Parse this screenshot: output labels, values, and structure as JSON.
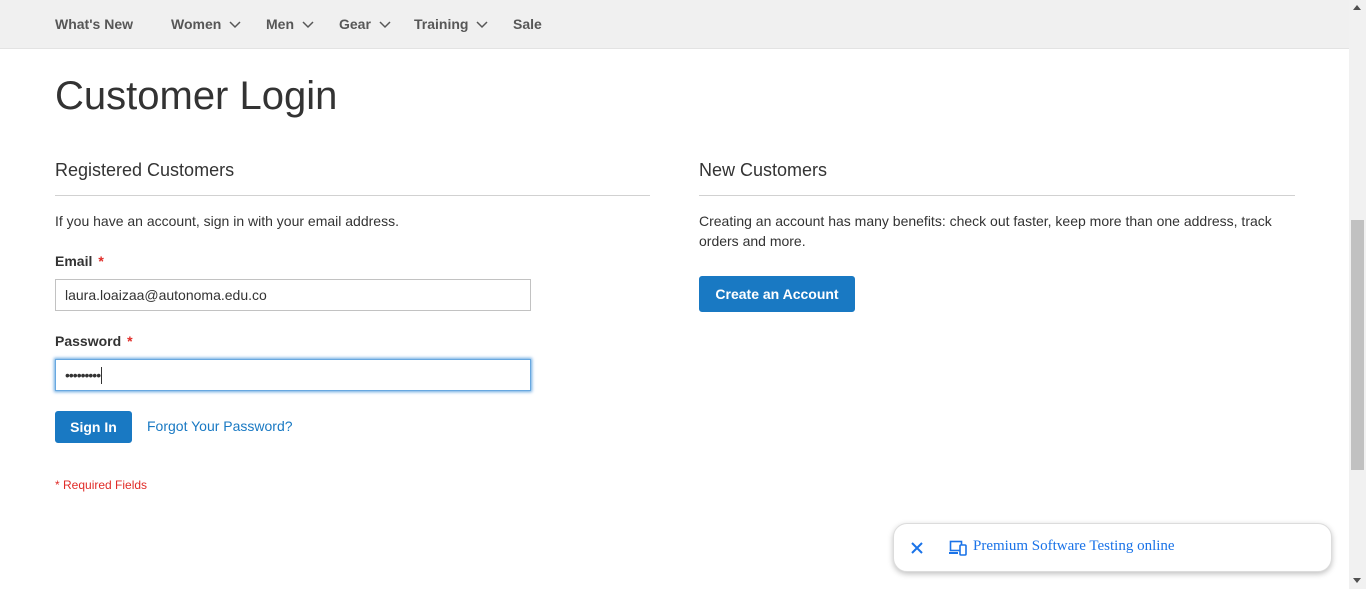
{
  "nav": {
    "items": [
      {
        "label": "What's New",
        "has_dropdown": false
      },
      {
        "label": "Women",
        "has_dropdown": true
      },
      {
        "label": "Men",
        "has_dropdown": true
      },
      {
        "label": "Gear",
        "has_dropdown": true
      },
      {
        "label": "Training",
        "has_dropdown": true
      },
      {
        "label": "Sale",
        "has_dropdown": false
      }
    ]
  },
  "page": {
    "title": "Customer Login"
  },
  "registered": {
    "title": "Registered Customers",
    "intro": "If you have an account, sign in with your email address.",
    "email_label": "Email",
    "email_value": "laura.loaizaa@autonoma.edu.co",
    "password_label": "Password",
    "password_value": "•••••••••",
    "required_marker": "*",
    "sign_in_label": "Sign In",
    "forgot_label": "Forgot Your Password?",
    "required_note": "* Required Fields"
  },
  "new_customers": {
    "title": "New Customers",
    "description": "Creating an account has many benefits: check out faster, keep more than one address, track orders and more.",
    "create_label": "Create an Account"
  },
  "promo": {
    "text": "Premium Software Testing online",
    "close_icon": "close-icon",
    "device_icon": "devices-icon"
  },
  "colors": {
    "accent": "#1979c3",
    "required": "#e02b27",
    "nav_bg": "#f0f0f0",
    "promo_link": "#1a73e8"
  }
}
